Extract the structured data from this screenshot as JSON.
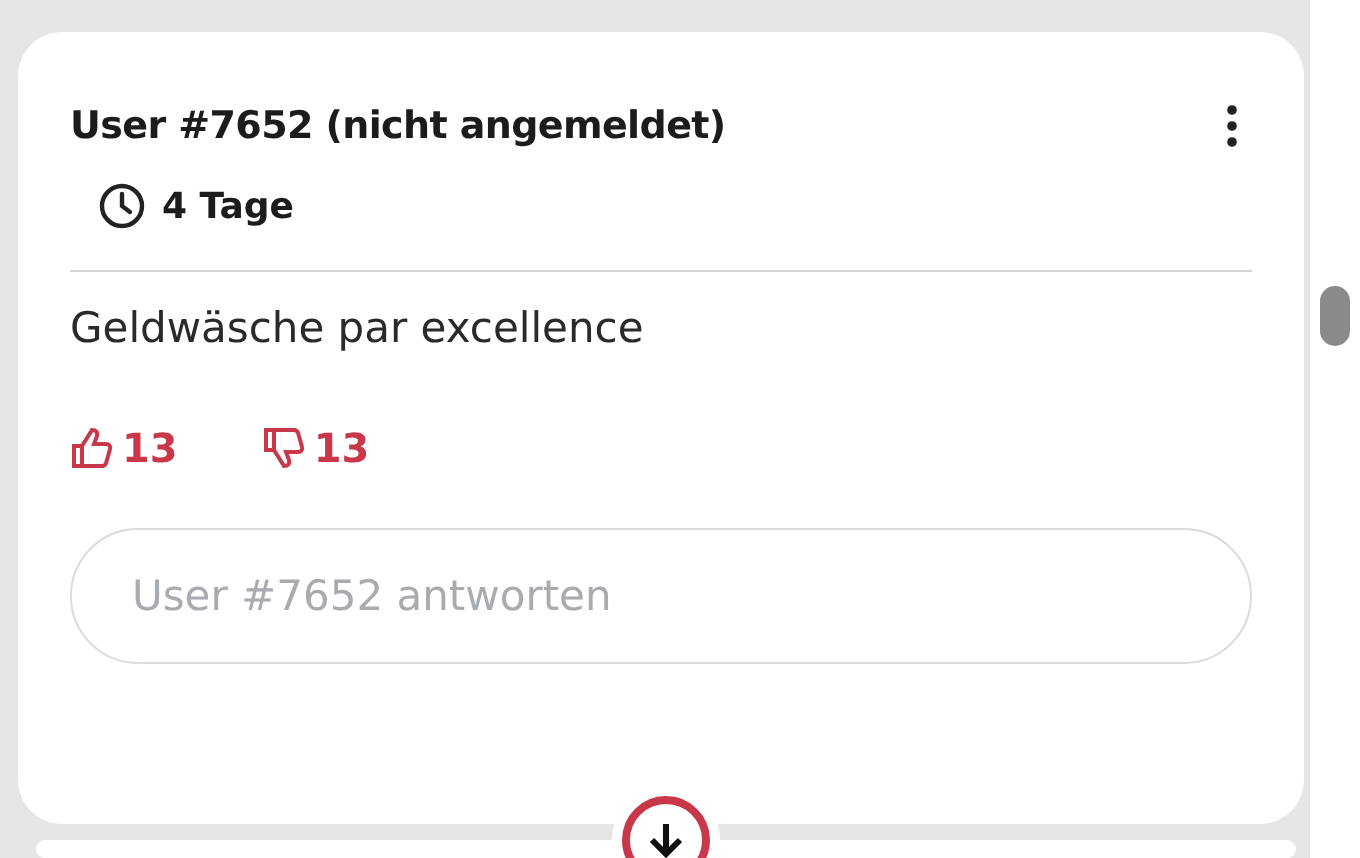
{
  "comment": {
    "author": "User #7652 (nicht angemeldet)",
    "age": "4 Tage",
    "text": "Geldwäsche par excellence",
    "likes": "13",
    "dislikes": "13",
    "reply": {
      "placeholder": "User #7652 antworten"
    }
  }
}
